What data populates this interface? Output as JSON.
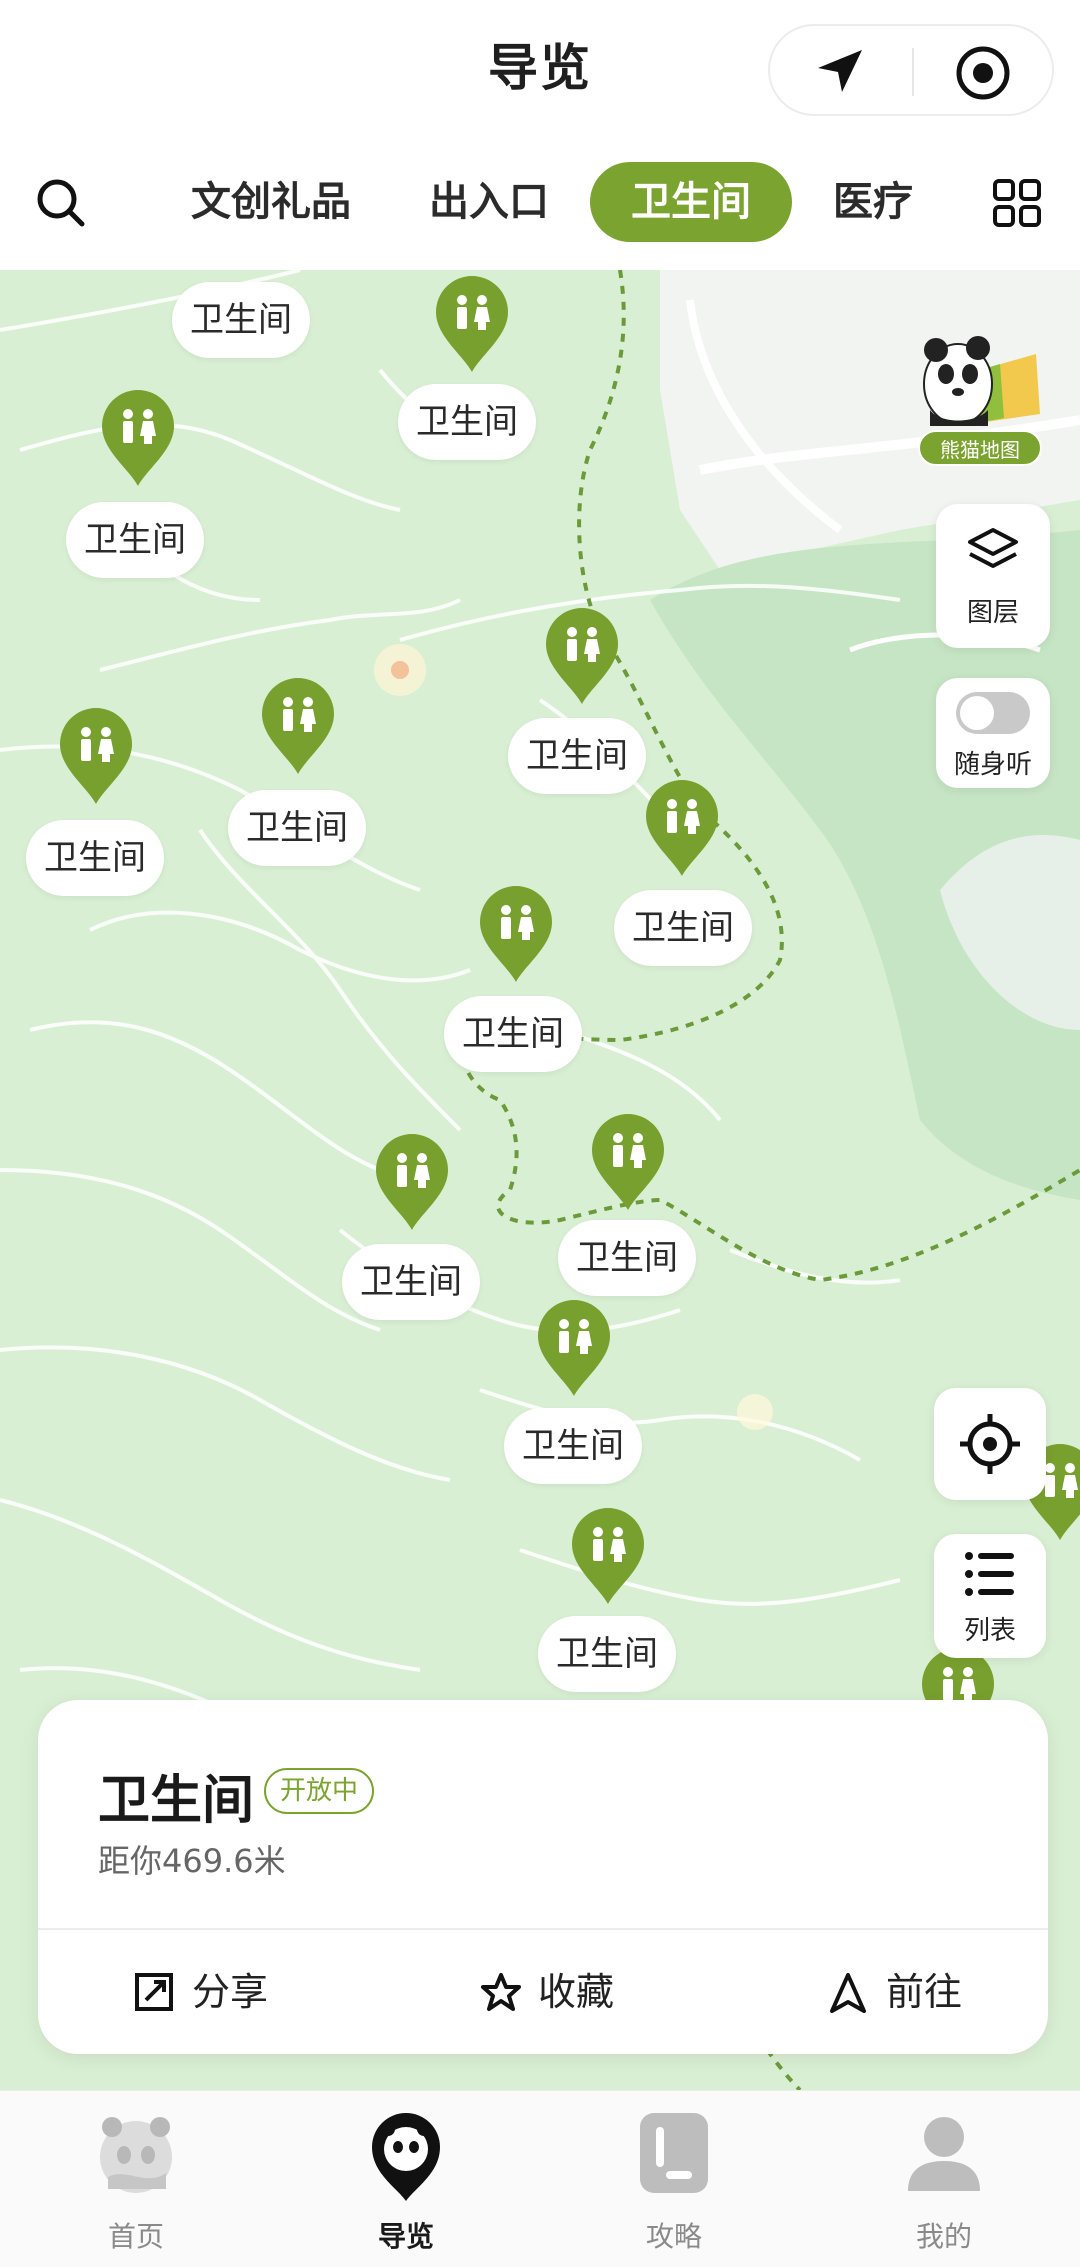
{
  "header": {
    "title": "导览",
    "navigate_icon": "navigation-arrow-icon",
    "record_icon": "target-circle-icon"
  },
  "tabs": {
    "search_icon": "search-icon",
    "items": [
      {
        "label": "文创礼品",
        "active": false
      },
      {
        "label": "出入口",
        "active": false
      },
      {
        "label": "卫生间",
        "active": true
      },
      {
        "label": "医疗",
        "active": false
      }
    ],
    "more_icon": "grid-icon"
  },
  "map": {
    "poi_label": "卫生间",
    "panda_map_label": "熊猫地图",
    "layers_label": "图层",
    "audio_guide_label": "随身听",
    "audio_guide_on": false,
    "list_label": "列表",
    "colors": {
      "accent": "#7ba32f",
      "land": "#d9efd3",
      "route": "#6b9a3a"
    }
  },
  "detail": {
    "name": "卫生间",
    "status": "开放中",
    "distance": "距你469.6米",
    "actions": [
      {
        "label": "分享",
        "icon": "share-icon"
      },
      {
        "label": "收藏",
        "icon": "star-icon"
      },
      {
        "label": "前往",
        "icon": "navigate-icon"
      }
    ]
  },
  "bottom_nav": [
    {
      "label": "首页",
      "icon": "panda-home-icon",
      "active": false
    },
    {
      "label": "导览",
      "icon": "panda-guide-icon",
      "active": true
    },
    {
      "label": "攻略",
      "icon": "guide-book-icon",
      "active": false
    },
    {
      "label": "我的",
      "icon": "user-icon",
      "active": false
    }
  ]
}
